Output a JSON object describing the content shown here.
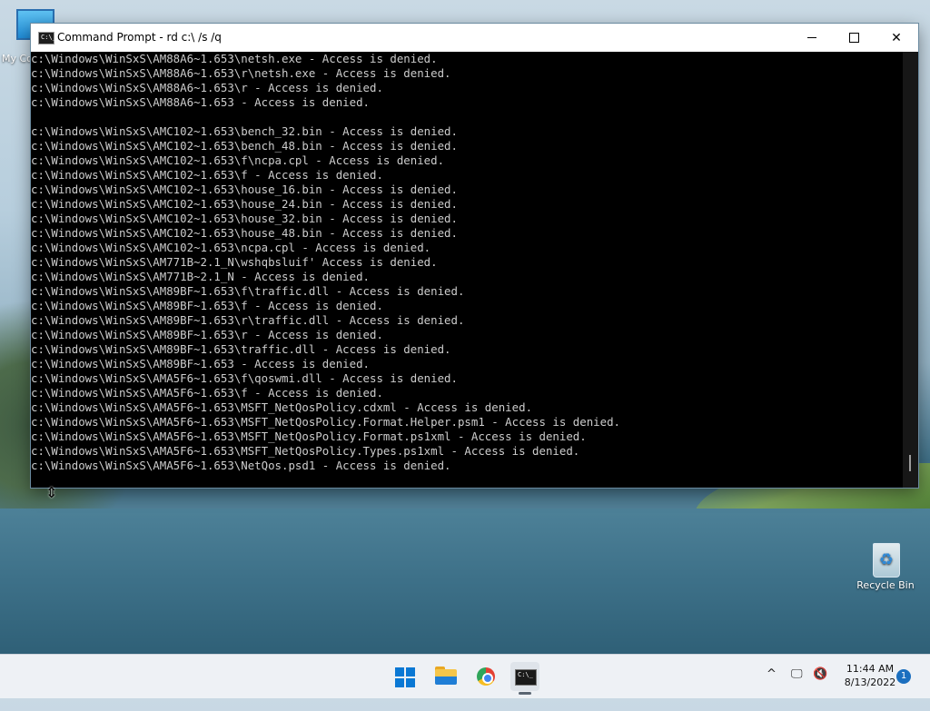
{
  "desktop": {
    "icons": [
      {
        "label": "My Co"
      },
      {
        "label": "Recycle Bin"
      }
    ]
  },
  "window": {
    "title": "Command Prompt - rd  c:\\ /s /q",
    "icon_text": "C:\\_",
    "minimize_icon": "minimize-icon",
    "maximize_icon": "maximize-icon",
    "close_label": "✕"
  },
  "console": {
    "lines": [
      "c:\\Windows\\WinSxS\\AM88A6~1.653\\netsh.exe - Access is denied.",
      "c:\\Windows\\WinSxS\\AM88A6~1.653\\r\\netsh.exe - Access is denied.",
      "c:\\Windows\\WinSxS\\AM88A6~1.653\\r - Access is denied.",
      "c:\\Windows\\WinSxS\\AM88A6~1.653 - Access is denied.",
      "",
      "c:\\Windows\\WinSxS\\AMC102~1.653\\bench_32.bin - Access is denied.",
      "c:\\Windows\\WinSxS\\AMC102~1.653\\bench_48.bin - Access is denied.",
      "c:\\Windows\\WinSxS\\AMC102~1.653\\f\\ncpa.cpl - Access is denied.",
      "c:\\Windows\\WinSxS\\AMC102~1.653\\f - Access is denied.",
      "c:\\Windows\\WinSxS\\AMC102~1.653\\house_16.bin - Access is denied.",
      "c:\\Windows\\WinSxS\\AMC102~1.653\\house_24.bin - Access is denied.",
      "c:\\Windows\\WinSxS\\AMC102~1.653\\house_32.bin - Access is denied.",
      "c:\\Windows\\WinSxS\\AMC102~1.653\\house_48.bin - Access is denied.",
      "c:\\Windows\\WinSxS\\AMC102~1.653\\ncpa.cpl - Access is denied.",
      "c:\\Windows\\WinSxS\\AM771B~2.1_N\\wshqbsluif' Access is denied.",
      "c:\\Windows\\WinSxS\\AM771B~2.1_N - Access is denied.",
      "c:\\Windows\\WinSxS\\AM89BF~1.653\\f\\traffic.dll - Access is denied.",
      "c:\\Windows\\WinSxS\\AM89BF~1.653\\f - Access is denied.",
      "c:\\Windows\\WinSxS\\AM89BF~1.653\\r\\traffic.dll - Access is denied.",
      "c:\\Windows\\WinSxS\\AM89BF~1.653\\r - Access is denied.",
      "c:\\Windows\\WinSxS\\AM89BF~1.653\\traffic.dll - Access is denied.",
      "c:\\Windows\\WinSxS\\AM89BF~1.653 - Access is denied.",
      "c:\\Windows\\WinSxS\\AMA5F6~1.653\\f\\qoswmi.dll - Access is denied.",
      "c:\\Windows\\WinSxS\\AMA5F6~1.653\\f - Access is denied.",
      "c:\\Windows\\WinSxS\\AMA5F6~1.653\\MSFT_NetQosPolicy.cdxml - Access is denied.",
      "c:\\Windows\\WinSxS\\AMA5F6~1.653\\MSFT_NetQosPolicy.Format.Helper.psm1 - Access is denied.",
      "c:\\Windows\\WinSxS\\AMA5F6~1.653\\MSFT_NetQosPolicy.Format.ps1xml - Access is denied.",
      "c:\\Windows\\WinSxS\\AMA5F6~1.653\\MSFT_NetQosPolicy.Types.ps1xml - Access is denied.",
      "c:\\Windows\\WinSxS\\AMA5F6~1.653\\NetQos.psd1 - Access is denied."
    ]
  },
  "taskbar": {
    "apps": [
      {
        "name": "start",
        "icon": "windows-start-icon"
      },
      {
        "name": "file-explorer",
        "icon": "folder-icon"
      },
      {
        "name": "chrome",
        "icon": "chrome-icon"
      },
      {
        "name": "command-prompt",
        "icon": "terminal-icon"
      }
    ],
    "tray": {
      "chevron": "^",
      "network_icon": "network-icon",
      "volume_icon": "volume-muted-icon"
    },
    "time": "11:44 AM",
    "date": "8/13/2022",
    "notification_count": "1"
  },
  "colors": {
    "console_bg": "#000000",
    "console_text": "#cccccc",
    "taskbar_bg": "#eef1f5",
    "accent": "#0a78d4"
  }
}
